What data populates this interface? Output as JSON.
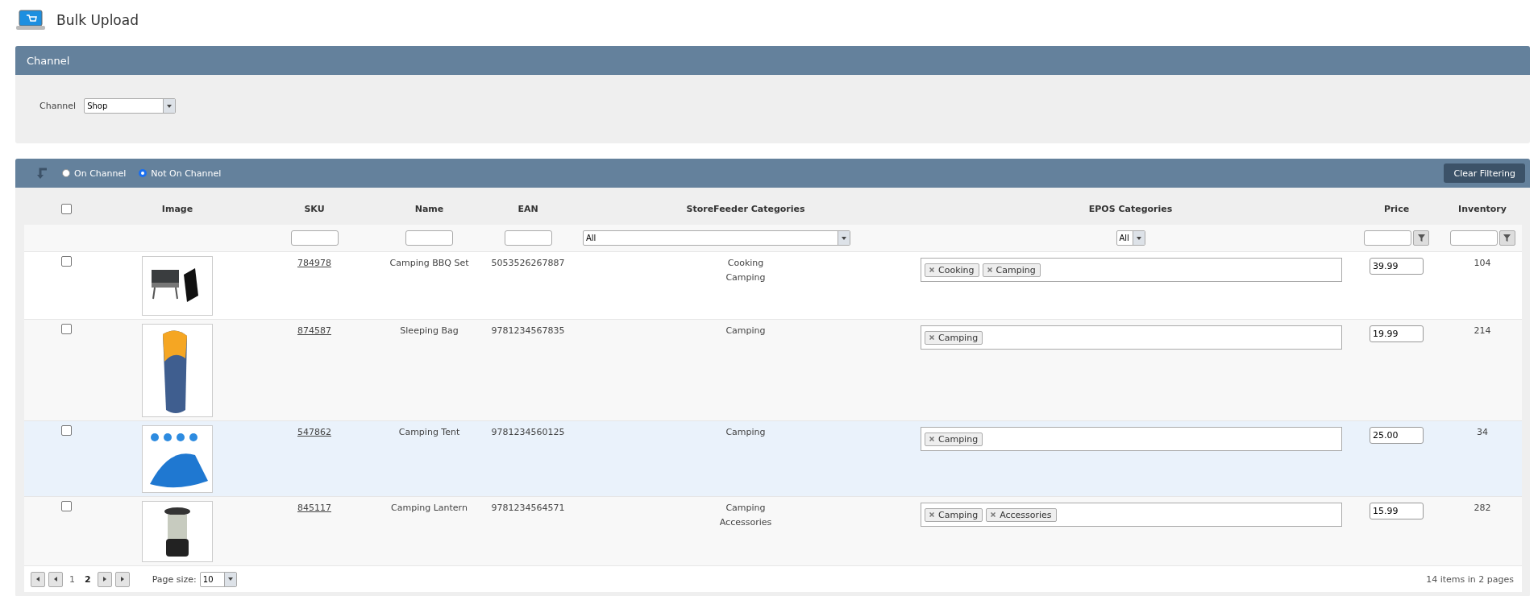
{
  "page": {
    "title": "Bulk Upload"
  },
  "channel_panel": {
    "header": "Channel",
    "label": "Channel",
    "value": "Shop"
  },
  "grid": {
    "radio_options": [
      {
        "label": "On Channel",
        "selected": false
      },
      {
        "label": "Not On Channel",
        "selected": true
      }
    ],
    "clear_button": "Clear Filtering",
    "select_all_checked": false,
    "columns": [
      {
        "label": "Image"
      },
      {
        "label": "SKU",
        "filter": {
          "kind": "text"
        }
      },
      {
        "label": "Name",
        "filter": {
          "kind": "text"
        }
      },
      {
        "label": "EAN",
        "filter": {
          "kind": "text"
        }
      },
      {
        "label": "StoreFeeder Categories",
        "filter": {
          "kind": "wide",
          "value": "All"
        }
      },
      {
        "label": "EPOS Categories",
        "filter": {
          "kind": "small",
          "value": "All"
        }
      },
      {
        "label": "Price",
        "filter": {
          "kind": "numeric"
        }
      },
      {
        "label": "Inventory",
        "filter": {
          "kind": "numeric"
        }
      }
    ],
    "rows": [
      {
        "checked": false,
        "highlighted": false,
        "photo": {
          "kind": "grill"
        },
        "sku": "784978",
        "name": "Camping BBQ Set",
        "ean": "5053526267887",
        "storefeeder_categories": [
          "Cooking",
          "Camping"
        ],
        "epos_categories": [
          "Cooking",
          "Camping"
        ],
        "price": "39.99",
        "inventory": "104"
      },
      {
        "checked": false,
        "highlighted": false,
        "photo": {
          "kind": "bag"
        },
        "sku": "874587",
        "name": "Sleeping Bag",
        "ean": "9781234567835",
        "storefeeder_categories": [
          "Camping"
        ],
        "epos_categories": [
          "Camping"
        ],
        "price": "19.99",
        "inventory": "214"
      },
      {
        "checked": false,
        "highlighted": true,
        "photo": {
          "kind": "tent"
        },
        "sku": "547862",
        "name": "Camping Tent",
        "ean": "9781234560125",
        "storefeeder_categories": [
          "Camping"
        ],
        "epos_categories": [
          "Camping"
        ],
        "price": "25.00",
        "inventory": "34"
      },
      {
        "checked": false,
        "highlighted": false,
        "photo": {
          "kind": "lantern"
        },
        "sku": "845117",
        "name": "Camping Lantern",
        "ean": "9781234564571",
        "storefeeder_categories": [
          "Camping",
          "Accessories"
        ],
        "epos_categories": [
          "Camping",
          "Accessories"
        ],
        "price": "15.99",
        "inventory": "282"
      }
    ],
    "pager": {
      "pages": [
        {
          "label": "1",
          "selected": false
        },
        {
          "label": "2",
          "selected": true
        }
      ],
      "page_size_label": "Page size:",
      "page_size": "10",
      "summary": "14 items in 2 pages"
    }
  }
}
